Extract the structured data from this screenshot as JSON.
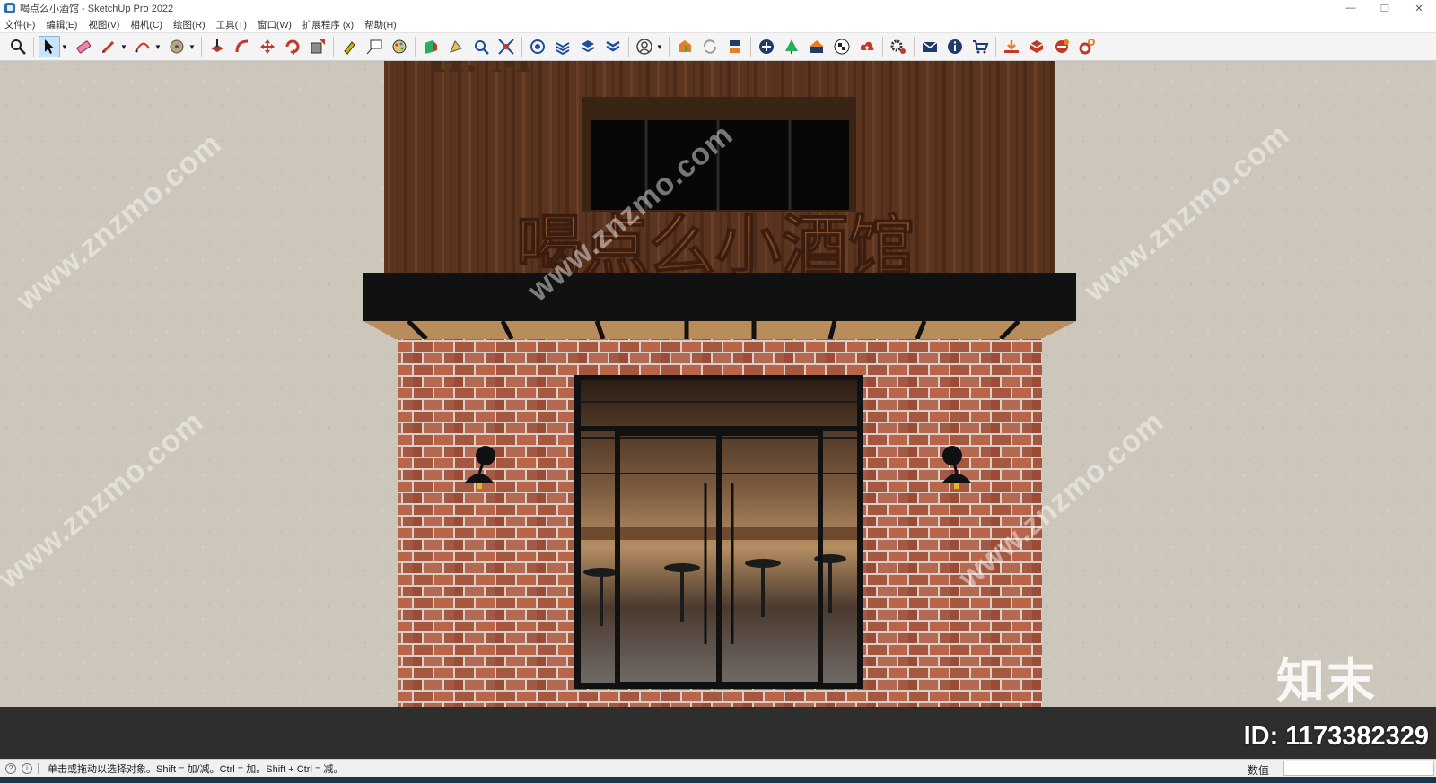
{
  "window": {
    "title": "喝点么小酒馆 - SketchUp Pro 2022",
    "minimize": "—",
    "restore": "❐",
    "close": "✕"
  },
  "menu": [
    "文件(F)",
    "编辑(E)",
    "视图(V)",
    "相机(C)",
    "绘图(R)",
    "工具(T)",
    "窗口(W)",
    "扩展程序 (x)",
    "帮助(H)"
  ],
  "toolbar": {
    "groups": [
      [
        "zoom-icon"
      ],
      [
        "select-icon",
        "eraser-icon",
        "pencil-icon",
        "arc-icon",
        "tape-measure-icon"
      ],
      [
        "push-pull-icon",
        "follow-me-icon",
        "move-icon",
        "rotate-icon",
        "scale-icon"
      ],
      [
        "paint-bucket-icon",
        "text-label-icon",
        "paint-icon"
      ],
      [
        "section-plane-icon",
        "walk-icon",
        "zoom-window-icon",
        "zoom-extents-icon"
      ],
      [
        "layers-icon",
        "components-icon",
        "styles-icon",
        "scenes-icon"
      ],
      [
        "account-icon"
      ],
      [
        "warehouse-icon",
        "refresh-icon",
        "export-icon"
      ],
      [
        "add-icon",
        "tree-icon",
        "house-icon",
        "checker-icon",
        "cloud-upload-icon"
      ],
      [
        "settings-icon"
      ],
      [
        "mail-icon",
        "info-icon",
        "cart-icon"
      ],
      [
        "extension-a-icon",
        "extension-b-icon",
        "extension-c-icon",
        "extension-d-icon"
      ]
    ]
  },
  "scene": {
    "sign_text": "喝点么小酒馆",
    "top_sign_text": "H. M",
    "watermark_text": "www.znzmo.com",
    "brand": "知末",
    "id_text": "ID: 1173382329"
  },
  "status": {
    "hint": "单击或拖动以选择对象。Shift = 加/减。Ctrl = 加。Shift + Ctrl = 减。",
    "measure_label": "数值",
    "measure_value": ""
  }
}
